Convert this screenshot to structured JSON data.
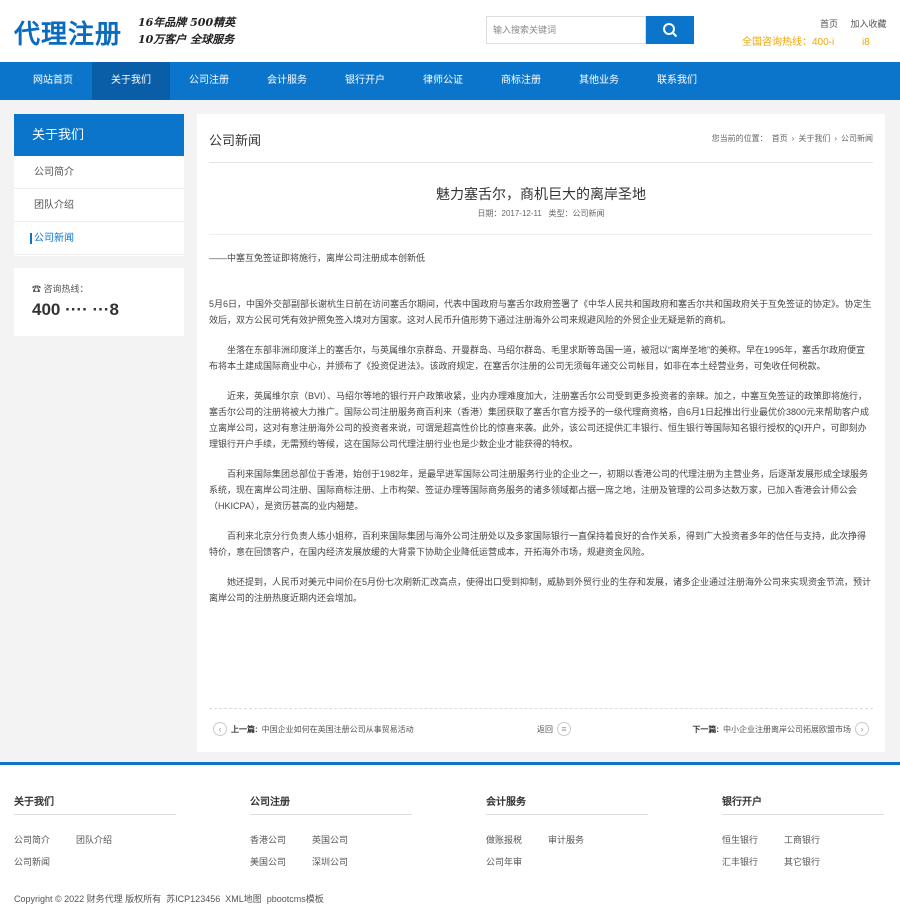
{
  "header": {
    "logo": "代理注册",
    "slogan_line1": "16年品牌 500精英",
    "slogan_line2": "10万客户 全球服务",
    "search_placeholder": "输入搜索关键词",
    "top_links": [
      "首页",
      "加入收藏"
    ],
    "hotline": "全国咨询热线：400-i          i8"
  },
  "nav": {
    "items": [
      "网站首页",
      "关于我们",
      "公司注册",
      "会计服务",
      "银行开户",
      "律师公证",
      "商标注册",
      "其他业务",
      "联系我们"
    ]
  },
  "sidebar": {
    "title": "关于我们",
    "items": [
      "公司简介",
      "团队介绍",
      "公司新闻"
    ],
    "contact_label": "咨询热线：",
    "contact_number": "400 ···· ···8"
  },
  "main": {
    "title": "公司新闻",
    "breadcrumb": [
      "您当前的位置：",
      "首页",
      "关于我们",
      "公司新闻"
    ],
    "article_title": "魅力塞舌尔，商机巨大的离岸圣地",
    "article_meta": "日期：2017-12-11   类型：公司新闻",
    "lead": "——中塞互免签证即将施行，离岸公司注册成本创新低",
    "paragraphs": [
      "5月6日，中国外交部副部长谢杭生日前在访问塞舌尔期间，代表中国政府与塞舌尔政府签署了《中华人民共和国政府和塞舌尔共和国政府关于互免签证的协定》。协定生效后，双方公民可凭有效护照免签入境对方国家。这对人民币升值形势下通过注册海外公司来规避风险的外贸企业无疑是新的商机。",
      "坐落在东部非洲印度洋上的塞舌尔，与英属维尔京群岛、开曼群岛、马绍尔群岛、毛里求斯等岛国一道，被冠以“离岸圣地”的美称。早在1995年，塞舌尔政府便宣布将本土建成国际商业中心，并颁布了《投资促进法》。该政府规定，在塞舌尔注册的公司无须每年递交公司帐目，如非在本土经营业务，可免收任何税款。",
      "近来，英属维尔京（BVI）、马绍尔等地的银行开户政策收紧，业内办理难度加大，注册塞舌尔公司受到更多投资者的亲睐。加之，中塞互免签证的政策即将施行，塞舌尔公司的注册将被大力推广。国际公司注册服务商百利来（香港）集团获取了塞舌尔官方授予的一级代理商资格，自6月1日起推出行业最优价3800元来帮助客户成立离岸公司，这对有意注册海外公司的投资者来说，可谓是超高性价比的惊喜来袭。此外，该公司还提供汇丰银行、恒生银行等国际知名银行授权的QI开户，可即刻办理银行开户手续，无需预约等候，这在国际公司代理注册行业也是少数企业才能获得的特权。",
      "百利来国际集团总部位于香港，始创于1982年，是最早进军国际公司注册服务行业的企业之一，初期以香港公司的代理注册为主营业务，后逐渐发展形成全球服务系统，现在离岸公司注册、国际商标注册、上市构架、签证办理等国际商务服务的诸多领域都占据一席之地，注册及管理的公司多达数万家，已加入香港会计师公会（HKICPA），是资历甚高的业内翘楚。",
      "百利来北京分行负责人练小姐称，百利来国际集团与海外公司注册处以及多家国际银行一直保持着良好的合作关系，得到广大投资者多年的信任与支持，此次挣得特价，意在回馈客户，在国内经济发展放缓的大背景下协助企业降低运营成本，开拓海外市场，规避资金风险。",
      "她还提到，人民币对美元中间价在5月份七次刷新汇改高点，使得出口受到抑制，威胁到外贸行业的生存和发展，诸多企业通过注册海外公司来实现资金节流，预计离岸公司的注册热度近期内还会增加。"
    ],
    "prev_label": "上一篇:",
    "prev_title": "中国企业如何在英国注册公司从事贸易活动",
    "back_label": "返回",
    "next_label": "下一篇:",
    "next_title": "中小企业注册离岸公司拓展欧盟市场"
  },
  "footer": {
    "columns": [
      {
        "title": "关于我们",
        "links": [
          "公司简介",
          "团队介绍",
          "公司新闻"
        ]
      },
      {
        "title": "公司注册",
        "links": [
          "香港公司",
          "英国公司",
          "美国公司",
          "深圳公司"
        ]
      },
      {
        "title": "会计服务",
        "links": [
          "做账报税",
          "审计服务",
          "公司年审"
        ]
      },
      {
        "title": "银行开户",
        "links": [
          "恒生银行",
          "工商银行",
          "汇丰银行",
          "其它银行"
        ]
      }
    ],
    "copyright": "Copyright © 2022 财务代理 版权所有  苏ICP123456  XML地图  pbootcms模板"
  }
}
